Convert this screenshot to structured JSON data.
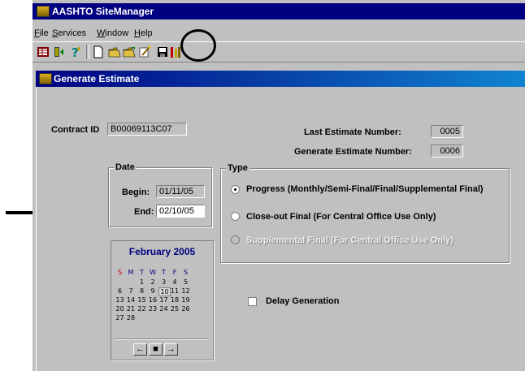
{
  "app": {
    "title": "AASHTO SiteManager",
    "menu": [
      {
        "label": "File",
        "mnemonic": "F",
        "rest": "ile"
      },
      {
        "label": "Services",
        "mnemonic": "S",
        "rest": "ervices"
      },
      {
        "label": "Window",
        "mnemonic": "W",
        "rest": "indow"
      },
      {
        "label": "Help",
        "mnemonic": "H",
        "rest": "elp"
      }
    ],
    "toolbar_icons": [
      "grid-icon",
      "exit-icon",
      "help-icon",
      "new-document-icon",
      "open-folder-icon",
      "open-folder-icon",
      "wizard-icon",
      "save-icon",
      "tools-icon"
    ]
  },
  "window": {
    "title": "Generate Estimate"
  },
  "form": {
    "contract_id_label": "Contract ID",
    "contract_id_value": "B00069113C07",
    "last_estimate_label": "Last Estimate Number:",
    "last_estimate_value": "0005",
    "generate_estimate_label": "Generate Estimate Number:",
    "generate_estimate_value": "0006",
    "date_group_label": "Date",
    "begin_label": "Begin:",
    "begin_value": "01/11/05",
    "end_label": "End:",
    "end_value": "02/10/05",
    "type_group_label": "Type",
    "type_options": [
      {
        "label": "Progress (Monthly/Semi-Final/Final/Supplemental Final)",
        "selected": true,
        "enabled": true
      },
      {
        "label": "Close-out Final (For Central Office Use Only)",
        "selected": false,
        "enabled": true
      },
      {
        "label": "Supplemental Final (For Central Office Use Only)",
        "selected": false,
        "enabled": false
      }
    ],
    "delay_generation_label": "Delay Generation",
    "delay_generation_checked": false
  },
  "calendar": {
    "month_label": "February 2005",
    "weekday_headers": [
      "S",
      "M",
      "T",
      "W",
      "T",
      "F",
      "S"
    ],
    "weeks": [
      [
        "",
        "",
        "1",
        "2",
        "3",
        "4",
        "5"
      ],
      [
        "6",
        "7",
        "8",
        "9",
        "10",
        "11",
        "12"
      ],
      [
        "13",
        "14",
        "15",
        "16",
        "17",
        "18",
        "19"
      ],
      [
        "20",
        "21",
        "22",
        "23",
        "24",
        "25",
        "26"
      ],
      [
        "27",
        "28",
        "",
        "",
        "",
        "",
        ""
      ]
    ],
    "selected_day": "10",
    "nav_prev": "←",
    "nav_today": "■",
    "nav_next": "→"
  },
  "colors": {
    "titlebar": "#000080",
    "face": "#c0c0c0",
    "calendar_month": "#000080"
  }
}
